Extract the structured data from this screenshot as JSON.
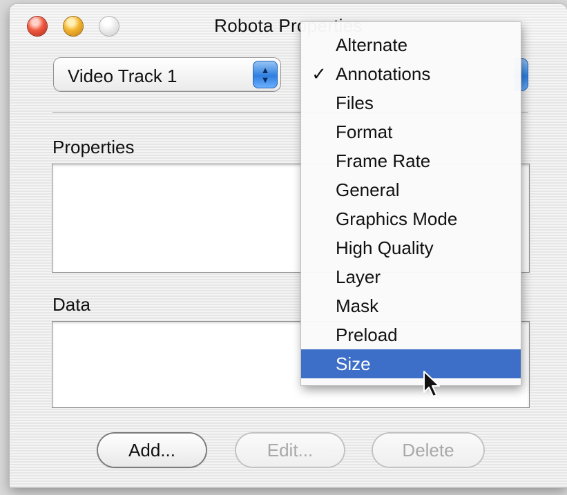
{
  "window": {
    "title": "Robota Properties"
  },
  "track_popup": {
    "value": "Video Track 1"
  },
  "sections": {
    "properties_label": "Properties",
    "data_label": "Data"
  },
  "buttons": {
    "add": "Add...",
    "edit": "Edit...",
    "delete": "Delete"
  },
  "menu": {
    "check_glyph": "✓",
    "items": [
      {
        "label": "Alternate",
        "checked": false,
        "highlighted": false
      },
      {
        "label": "Annotations",
        "checked": true,
        "highlighted": false
      },
      {
        "label": "Files",
        "checked": false,
        "highlighted": false
      },
      {
        "label": "Format",
        "checked": false,
        "highlighted": false
      },
      {
        "label": "Frame Rate",
        "checked": false,
        "highlighted": false
      },
      {
        "label": "General",
        "checked": false,
        "highlighted": false
      },
      {
        "label": "Graphics Mode",
        "checked": false,
        "highlighted": false
      },
      {
        "label": "High Quality",
        "checked": false,
        "highlighted": false
      },
      {
        "label": "Layer",
        "checked": false,
        "highlighted": false
      },
      {
        "label": "Mask",
        "checked": false,
        "highlighted": false
      },
      {
        "label": "Preload",
        "checked": false,
        "highlighted": false
      },
      {
        "label": "Size",
        "checked": false,
        "highlighted": true
      }
    ]
  },
  "colors": {
    "highlight": "#3d6fc8",
    "accent_blue": "#2f7fe0"
  }
}
